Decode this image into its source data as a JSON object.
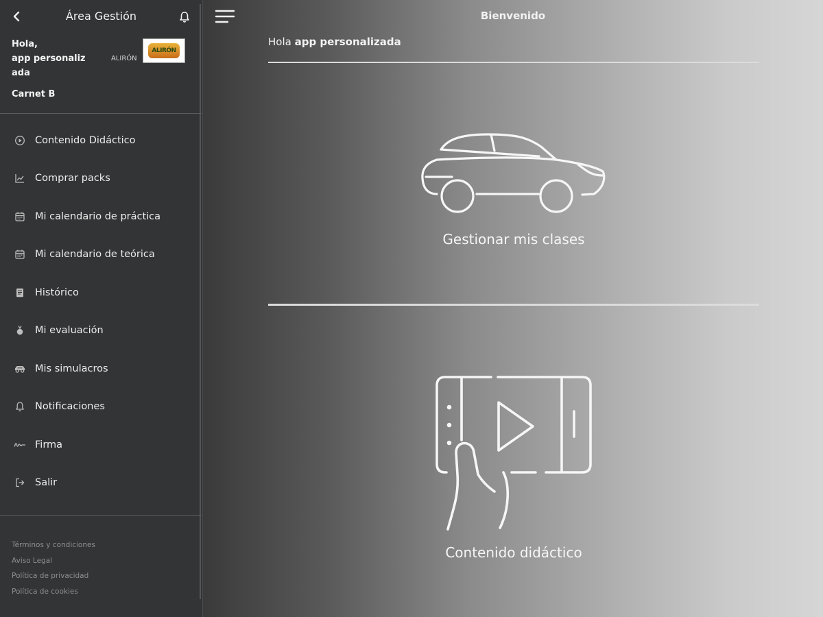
{
  "sidebar": {
    "title": "Área Gestión",
    "greeting_prefix": "Hola,",
    "user_name": "app personaliz ada",
    "school_name": "ALIRÓN",
    "logo_text": "ALIRÓN",
    "license": "Carnet B",
    "items": [
      {
        "label": "Contenido Didáctico",
        "icon": "play-circle-icon"
      },
      {
        "label": "Comprar packs",
        "icon": "chart-line-icon"
      },
      {
        "label": "Mi calendario de práctica",
        "icon": "calendar-icon"
      },
      {
        "label": "Mi calendario de teórica",
        "icon": "calendar-icon"
      },
      {
        "label": "Histórico",
        "icon": "book-icon"
      },
      {
        "label": "Mi evaluación",
        "icon": "medal-icon"
      },
      {
        "label": "Mis simulacros",
        "icon": "car-icon"
      },
      {
        "label": "Notificaciones",
        "icon": "bell-icon"
      },
      {
        "label": "Firma",
        "icon": "signature-icon"
      },
      {
        "label": "Salir",
        "icon": "logout-icon"
      }
    ],
    "legal": [
      "Términos y condiciones",
      "Aviso Legal",
      "Política de privacidad",
      "Política de cookies"
    ]
  },
  "main": {
    "title": "Bienvenido",
    "hello_prefix": "Hola",
    "hello_name": "app personalizada",
    "cards": [
      {
        "label": "Gestionar mis clases",
        "icon": "car-icon"
      },
      {
        "label": "Contenido didáctico",
        "icon": "tablet-video-icon"
      }
    ]
  }
}
